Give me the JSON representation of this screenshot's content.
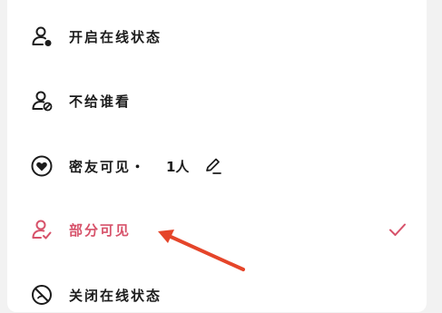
{
  "menu": {
    "items": [
      {
        "label": "开启在线状态",
        "icon": "user-online-icon"
      },
      {
        "label": "不给谁看",
        "icon": "user-blocked-icon"
      },
      {
        "label": "密友可见・",
        "icon": "heart-circle-icon",
        "count": "1人",
        "edit_icon": "pencil-icon"
      },
      {
        "label": "部分可见",
        "icon": "user-check-icon",
        "selected": true,
        "check_icon": "checkmark-icon"
      },
      {
        "label": "关闭在线状态",
        "icon": "offline-circle-icon"
      }
    ]
  },
  "colors": {
    "accent": "#d7526a",
    "text": "#1c1c1c",
    "annotation_arrow": "#e5452a",
    "background": "#ffffff"
  }
}
